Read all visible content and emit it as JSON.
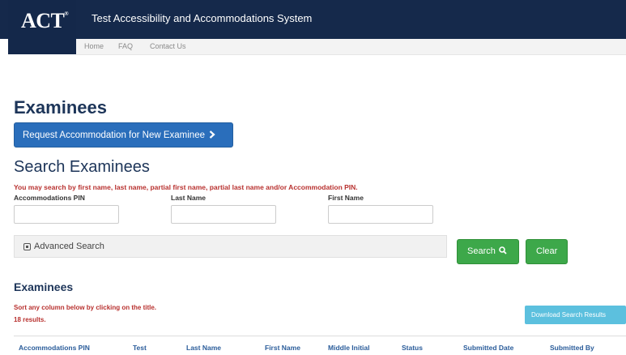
{
  "header": {
    "logo": "ACT",
    "logo_mark": "®",
    "title": "Test Accessibility and Accommodations System"
  },
  "nav": {
    "home": "Home",
    "faq": "FAQ",
    "contact": "Contact Us"
  },
  "page": {
    "title": "Examinees",
    "request_button": "Request Accommodation for New Examinee"
  },
  "search": {
    "title": "Search Examinees",
    "help": "You may search by first name, last name, partial first name, partial last name and/or Accommodation PIN.",
    "pin_label": "Accommodations PIN",
    "pin_value": "",
    "last_label": "Last Name",
    "last_value": "",
    "first_label": "First Name",
    "first_value": "",
    "advanced": "Advanced Search",
    "search_button": "Search",
    "clear_button": "Clear"
  },
  "results": {
    "title": "Examinees",
    "sort_hint": "Sort any column below by clicking on the title.",
    "count": "18 results.",
    "download_button": "Download Search Results",
    "columns": [
      "Accommodations PIN",
      "Test",
      "Last Name",
      "First Name",
      "Middle Initial",
      "Status",
      "Submitted Date",
      "Submitted By"
    ]
  },
  "colors": {
    "navy": "#15294b",
    "blue_button": "#2a6ebb",
    "green_button": "#3da84a",
    "info_button": "#5cc0de",
    "error_text": "#b8312f"
  }
}
